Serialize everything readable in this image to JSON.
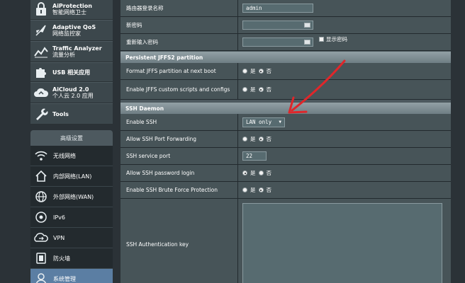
{
  "sidebar": {
    "general": [
      {
        "id": "aiprotection",
        "icon": "lock-icon",
        "title": "AiProtection",
        "subtitle": "智能网络卫士"
      },
      {
        "id": "adaptive-qos",
        "icon": "qos-rocket-icon",
        "title": "Adaptive QoS",
        "subtitle": "网络监控家"
      },
      {
        "id": "traffic-analyzer",
        "icon": "chart-icon",
        "title": "Traffic Analyzer",
        "subtitle": "流量分析"
      },
      {
        "id": "usb",
        "icon": "puzzle-icon",
        "title": "USB 相关应用",
        "subtitle": ""
      },
      {
        "id": "aicloud",
        "icon": "cloud-icon",
        "title": "AiCloud 2.0",
        "subtitle": "个人云 2.0 应用"
      },
      {
        "id": "tools",
        "icon": "wrench-icon",
        "title": "Tools",
        "subtitle": ""
      }
    ],
    "advanced_header": "高级设置",
    "advanced": [
      {
        "id": "wireless",
        "icon": "wifi-icon",
        "label": "无线网络"
      },
      {
        "id": "lan",
        "icon": "home-icon",
        "label": "内部网络(LAN)"
      },
      {
        "id": "wan",
        "icon": "globe-icon",
        "label": "外部网络(WAN)"
      },
      {
        "id": "ipv6",
        "icon": "ipv6-icon",
        "label": "IPv6"
      },
      {
        "id": "vpn",
        "icon": "vpn-icon",
        "label": "VPN"
      },
      {
        "id": "firewall",
        "icon": "shield-icon",
        "label": "防火墙"
      },
      {
        "id": "admin",
        "icon": "user-icon",
        "label": "系统管理"
      }
    ]
  },
  "form": {
    "router_login_name": {
      "label": "路由器登录名称",
      "value": "admin"
    },
    "new_password": {
      "label": "新密码"
    },
    "retype_password": {
      "label": "重新输入密码",
      "show_password_label": "显示密码"
    },
    "jffs_section": "Persistent JFFS2 partition",
    "format_jffs": {
      "label": "Format JFFS partition at next boot",
      "yes": "是",
      "no": "否",
      "selected": "no"
    },
    "enable_jffs_scripts": {
      "label": "Enable JFFS custom scripts and configs",
      "yes": "是",
      "no": "否",
      "selected": "no"
    },
    "ssh_section": "SSH Daemon",
    "enable_ssh": {
      "label": "Enable SSH",
      "value": "LAN only"
    },
    "ssh_port_forwarding": {
      "label": "Allow SSH Port Forwarding",
      "yes": "是",
      "no": "否",
      "selected": "no"
    },
    "ssh_service_port": {
      "label": "SSH service port",
      "value": "22"
    },
    "ssh_password_login": {
      "label": "Allow SSH password login",
      "yes": "是",
      "no": "否",
      "selected": "yes"
    },
    "ssh_brute_force": {
      "label": "Enable SSH Brute Force Protection",
      "yes": "是",
      "no": "否",
      "selected": "no"
    },
    "ssh_auth_key": {
      "label": "SSH Authentication key"
    }
  },
  "colors": {
    "background": "#2b3237",
    "panel": "#4d595f",
    "active_nav": "#5b7ea3",
    "annotation_arrow": "#e0262a"
  }
}
